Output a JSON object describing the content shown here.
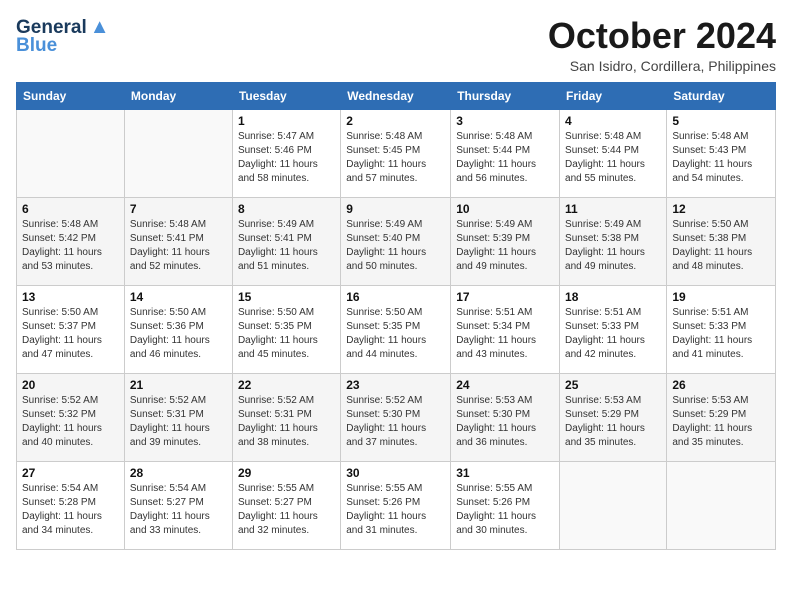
{
  "logo": {
    "line1": "General",
    "line2": "Blue",
    "bird_symbol": "▲"
  },
  "title": "October 2024",
  "location": "San Isidro, Cordillera, Philippines",
  "weekdays": [
    "Sunday",
    "Monday",
    "Tuesday",
    "Wednesday",
    "Thursday",
    "Friday",
    "Saturday"
  ],
  "weeks": [
    [
      {
        "day": "",
        "sunrise": "",
        "sunset": "",
        "daylight": ""
      },
      {
        "day": "",
        "sunrise": "",
        "sunset": "",
        "daylight": ""
      },
      {
        "day": "1",
        "sunrise": "Sunrise: 5:47 AM",
        "sunset": "Sunset: 5:46 PM",
        "daylight": "Daylight: 11 hours and 58 minutes."
      },
      {
        "day": "2",
        "sunrise": "Sunrise: 5:48 AM",
        "sunset": "Sunset: 5:45 PM",
        "daylight": "Daylight: 11 hours and 57 minutes."
      },
      {
        "day": "3",
        "sunrise": "Sunrise: 5:48 AM",
        "sunset": "Sunset: 5:44 PM",
        "daylight": "Daylight: 11 hours and 56 minutes."
      },
      {
        "day": "4",
        "sunrise": "Sunrise: 5:48 AM",
        "sunset": "Sunset: 5:44 PM",
        "daylight": "Daylight: 11 hours and 55 minutes."
      },
      {
        "day": "5",
        "sunrise": "Sunrise: 5:48 AM",
        "sunset": "Sunset: 5:43 PM",
        "daylight": "Daylight: 11 hours and 54 minutes."
      }
    ],
    [
      {
        "day": "6",
        "sunrise": "Sunrise: 5:48 AM",
        "sunset": "Sunset: 5:42 PM",
        "daylight": "Daylight: 11 hours and 53 minutes."
      },
      {
        "day": "7",
        "sunrise": "Sunrise: 5:48 AM",
        "sunset": "Sunset: 5:41 PM",
        "daylight": "Daylight: 11 hours and 52 minutes."
      },
      {
        "day": "8",
        "sunrise": "Sunrise: 5:49 AM",
        "sunset": "Sunset: 5:41 PM",
        "daylight": "Daylight: 11 hours and 51 minutes."
      },
      {
        "day": "9",
        "sunrise": "Sunrise: 5:49 AM",
        "sunset": "Sunset: 5:40 PM",
        "daylight": "Daylight: 11 hours and 50 minutes."
      },
      {
        "day": "10",
        "sunrise": "Sunrise: 5:49 AM",
        "sunset": "Sunset: 5:39 PM",
        "daylight": "Daylight: 11 hours and 49 minutes."
      },
      {
        "day": "11",
        "sunrise": "Sunrise: 5:49 AM",
        "sunset": "Sunset: 5:38 PM",
        "daylight": "Daylight: 11 hours and 49 minutes."
      },
      {
        "day": "12",
        "sunrise": "Sunrise: 5:50 AM",
        "sunset": "Sunset: 5:38 PM",
        "daylight": "Daylight: 11 hours and 48 minutes."
      }
    ],
    [
      {
        "day": "13",
        "sunrise": "Sunrise: 5:50 AM",
        "sunset": "Sunset: 5:37 PM",
        "daylight": "Daylight: 11 hours and 47 minutes."
      },
      {
        "day": "14",
        "sunrise": "Sunrise: 5:50 AM",
        "sunset": "Sunset: 5:36 PM",
        "daylight": "Daylight: 11 hours and 46 minutes."
      },
      {
        "day": "15",
        "sunrise": "Sunrise: 5:50 AM",
        "sunset": "Sunset: 5:35 PM",
        "daylight": "Daylight: 11 hours and 45 minutes."
      },
      {
        "day": "16",
        "sunrise": "Sunrise: 5:50 AM",
        "sunset": "Sunset: 5:35 PM",
        "daylight": "Daylight: 11 hours and 44 minutes."
      },
      {
        "day": "17",
        "sunrise": "Sunrise: 5:51 AM",
        "sunset": "Sunset: 5:34 PM",
        "daylight": "Daylight: 11 hours and 43 minutes."
      },
      {
        "day": "18",
        "sunrise": "Sunrise: 5:51 AM",
        "sunset": "Sunset: 5:33 PM",
        "daylight": "Daylight: 11 hours and 42 minutes."
      },
      {
        "day": "19",
        "sunrise": "Sunrise: 5:51 AM",
        "sunset": "Sunset: 5:33 PM",
        "daylight": "Daylight: 11 hours and 41 minutes."
      }
    ],
    [
      {
        "day": "20",
        "sunrise": "Sunrise: 5:52 AM",
        "sunset": "Sunset: 5:32 PM",
        "daylight": "Daylight: 11 hours and 40 minutes."
      },
      {
        "day": "21",
        "sunrise": "Sunrise: 5:52 AM",
        "sunset": "Sunset: 5:31 PM",
        "daylight": "Daylight: 11 hours and 39 minutes."
      },
      {
        "day": "22",
        "sunrise": "Sunrise: 5:52 AM",
        "sunset": "Sunset: 5:31 PM",
        "daylight": "Daylight: 11 hours and 38 minutes."
      },
      {
        "day": "23",
        "sunrise": "Sunrise: 5:52 AM",
        "sunset": "Sunset: 5:30 PM",
        "daylight": "Daylight: 11 hours and 37 minutes."
      },
      {
        "day": "24",
        "sunrise": "Sunrise: 5:53 AM",
        "sunset": "Sunset: 5:30 PM",
        "daylight": "Daylight: 11 hours and 36 minutes."
      },
      {
        "day": "25",
        "sunrise": "Sunrise: 5:53 AM",
        "sunset": "Sunset: 5:29 PM",
        "daylight": "Daylight: 11 hours and 35 minutes."
      },
      {
        "day": "26",
        "sunrise": "Sunrise: 5:53 AM",
        "sunset": "Sunset: 5:29 PM",
        "daylight": "Daylight: 11 hours and 35 minutes."
      }
    ],
    [
      {
        "day": "27",
        "sunrise": "Sunrise: 5:54 AM",
        "sunset": "Sunset: 5:28 PM",
        "daylight": "Daylight: 11 hours and 34 minutes."
      },
      {
        "day": "28",
        "sunrise": "Sunrise: 5:54 AM",
        "sunset": "Sunset: 5:27 PM",
        "daylight": "Daylight: 11 hours and 33 minutes."
      },
      {
        "day": "29",
        "sunrise": "Sunrise: 5:55 AM",
        "sunset": "Sunset: 5:27 PM",
        "daylight": "Daylight: 11 hours and 32 minutes."
      },
      {
        "day": "30",
        "sunrise": "Sunrise: 5:55 AM",
        "sunset": "Sunset: 5:26 PM",
        "daylight": "Daylight: 11 hours and 31 minutes."
      },
      {
        "day": "31",
        "sunrise": "Sunrise: 5:55 AM",
        "sunset": "Sunset: 5:26 PM",
        "daylight": "Daylight: 11 hours and 30 minutes."
      },
      {
        "day": "",
        "sunrise": "",
        "sunset": "",
        "daylight": ""
      },
      {
        "day": "",
        "sunrise": "",
        "sunset": "",
        "daylight": ""
      }
    ]
  ]
}
